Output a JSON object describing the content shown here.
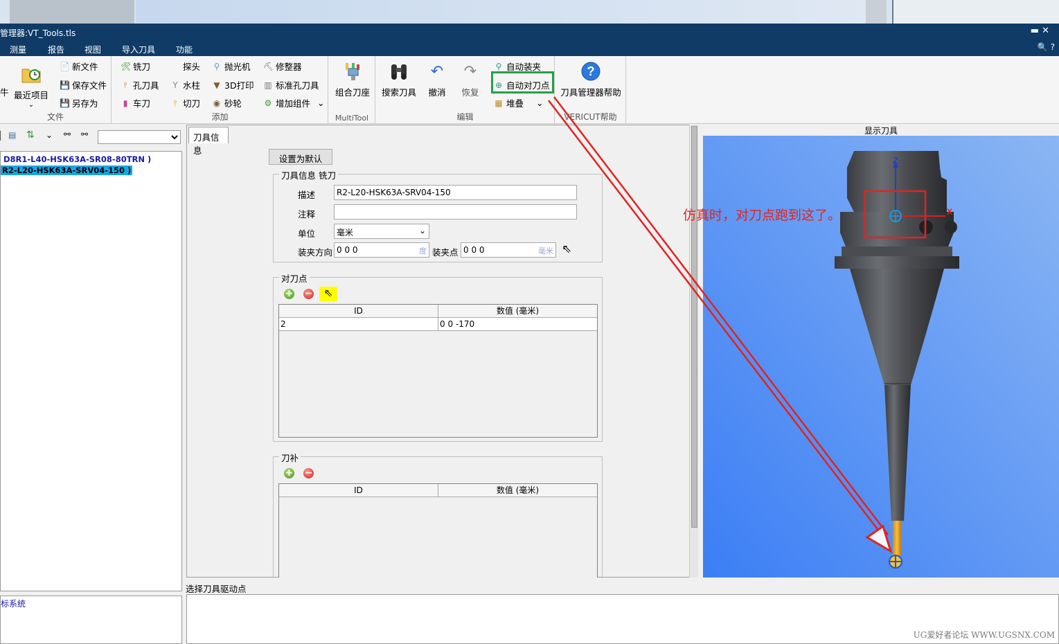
{
  "window": {
    "title": "管理器:VT_Tools.tls",
    "controls": "▬ ✕"
  },
  "menu": {
    "items": [
      "测量",
      "报告",
      "视图",
      "导入刀具",
      "功能"
    ],
    "right": "🔍 ?"
  },
  "ribbon": {
    "file_group": {
      "label": "文件",
      "recent": "最近项目",
      "new_file": "新文件",
      "save_file": "保存文件",
      "save_as": "另存为",
      "partial": "牛"
    },
    "add_group": {
      "label": "添加",
      "mill": "铣刀",
      "probe": "探头",
      "polisher": "抛光机",
      "dresser": "修整器",
      "hole_tool": "孔刀具",
      "waterjet": "水柱",
      "print3d": "3D打印",
      "std_hole": "标准孔刀具",
      "turning": "车刀",
      "cutoff": "切刀",
      "wheel": "砂轮",
      "add_comp": "增加组件"
    },
    "multitool_group": {
      "label": "MultiTool",
      "combo": "组合刀座"
    },
    "edit_group": {
      "label": "编辑",
      "search": "搜索刀具",
      "undo": "撤消",
      "redo": "恢复",
      "auto_clamp": "自动装夹",
      "auto_driven": "自动对刀点",
      "stack": "堆叠"
    },
    "help_group": {
      "label": "VERICUT帮助",
      "help": "刀具管理器帮助"
    }
  },
  "tree": {
    "items": [
      "D8R1-L40-HSK63A-SR08-80TRN )",
      "R2-L20-HSK63A-SRV04-150 )"
    ]
  },
  "coord_pane": {
    "label": "标系统"
  },
  "form": {
    "tab": "刀具信息",
    "set_default": "设置为默认",
    "tool_info": {
      "legend": "刀具信息 铣刀",
      "desc_label": "描述",
      "desc_value": "R2-L20-HSK63A-SRV04-150",
      "comment_label": "注释",
      "comment_value": "",
      "units_label": "单位",
      "units_value": "毫米",
      "gage_dir_label": "装夹方向",
      "gage_dir_value": "0 0 0",
      "gage_dir_unit": "度",
      "gage_pt_label": "装夹点",
      "gage_pt_value": "0 0 0",
      "gage_pt_unit": "毫米"
    },
    "driven_points": {
      "legend": "对刀点",
      "col_id": "ID",
      "col_value": "数值 (毫米)",
      "rows": [
        {
          "id": "2",
          "value": "0 0 -170"
        }
      ]
    },
    "cutter_comp": {
      "legend": "刀补",
      "col_id": "ID",
      "col_value": "数值 (毫米)"
    }
  },
  "status": "选择刀具驱动点",
  "viewer": {
    "title": "显示刀具",
    "axis_z": "Z",
    "axis_x": "X",
    "annotation": "仿真时，对刀点跑到这了。"
  },
  "watermark": "UG爱好者论坛 WWW.UGSNX.COM",
  "colors": {
    "titlebar": "#0f3b66",
    "viewer_bg": "#4f8ff0",
    "annotation": "#e0241f",
    "highlight_box": "#23a145",
    "tree_selection": "#16a7e6"
  }
}
